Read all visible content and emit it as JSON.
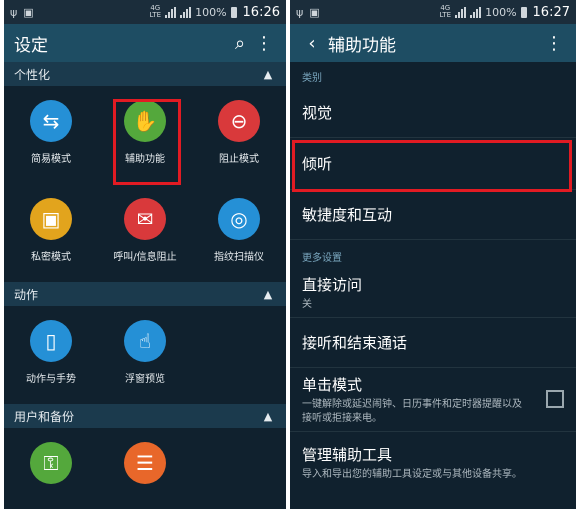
{
  "left": {
    "status": {
      "network": "4G",
      "network_sub": "LTE",
      "battery": "100%",
      "time": "16:26"
    },
    "appbar": {
      "title": "设定"
    },
    "sections": [
      {
        "title": "个性化",
        "items": [
          {
            "label": "简易模式",
            "icon": "easy-mode-icon",
            "color": "#2590d6",
            "glyph": "⇆"
          },
          {
            "label": "辅助功能",
            "icon": "hand-icon",
            "color": "#54a83c",
            "glyph": "✋"
          },
          {
            "label": "阻止模式",
            "icon": "blocking-mode-icon",
            "color": "#d9393b",
            "glyph": "⊖"
          },
          {
            "label": "私密模式",
            "icon": "private-mode-icon",
            "color": "#e2a41d",
            "glyph": "🔒"
          },
          {
            "label": "呼叫/信息阻止",
            "icon": "call-block-icon",
            "color": "#d9393b",
            "glyph": "✉"
          },
          {
            "label": "指纹扫描仪",
            "icon": "fingerprint-icon",
            "color": "#2590d6",
            "glyph": "◎"
          }
        ]
      },
      {
        "title": "动作",
        "items": [
          {
            "label": "动作与手势",
            "icon": "motions-icon",
            "color": "#2590d6",
            "glyph": "▯"
          },
          {
            "label": "浮窗预览",
            "icon": "air-view-icon",
            "color": "#2590d6",
            "glyph": "☝"
          }
        ]
      },
      {
        "title": "用户和备份",
        "items": [
          {
            "label": "",
            "icon": "key-icon",
            "color": "#54a83c",
            "glyph": "⚿"
          },
          {
            "label": "",
            "icon": "backup-icon",
            "color": "#e8672a",
            "glyph": "☰"
          }
        ]
      }
    ]
  },
  "right": {
    "status": {
      "network": "4G",
      "network_sub": "LTE",
      "battery": "100%",
      "time": "16:27"
    },
    "appbar": {
      "title": "辅助功能"
    },
    "category_label": "类别",
    "categories": [
      "视觉",
      "倾听",
      "敏捷度和互动"
    ],
    "more_label": "更多设置",
    "more_items": [
      {
        "title": "直接访问",
        "sub": "关"
      },
      {
        "title": "接听和结束通话",
        "sub": ""
      },
      {
        "title": "单击模式",
        "sub": "一键解除或延迟闹钟、日历事件和定时器提醒以及接听或拒接来电。"
      },
      {
        "title": "管理辅助工具",
        "sub": "导入和导出您的辅助工具设定或与其他设备共享。"
      }
    ]
  },
  "colors": {
    "highlight": "#e21b23",
    "appbar": "#1e4d63",
    "background": "#10212e"
  }
}
